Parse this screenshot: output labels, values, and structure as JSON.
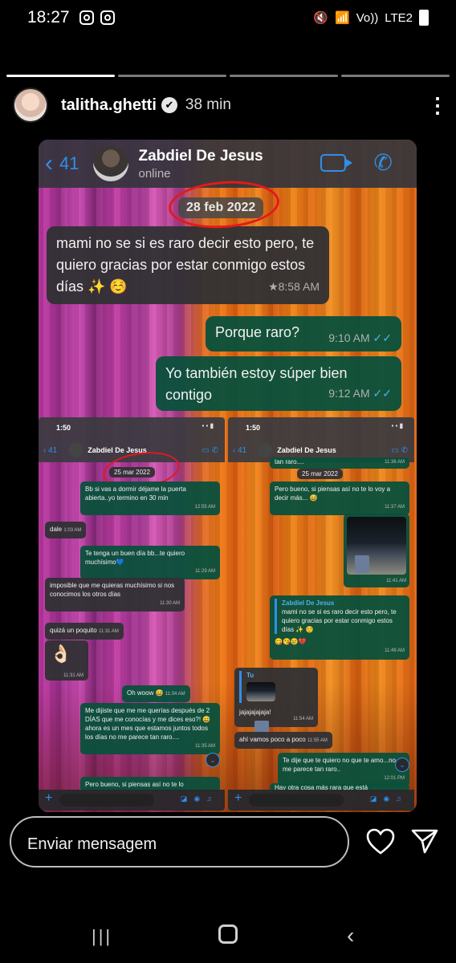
{
  "status_bar": {
    "time": "18:27",
    "network": "LTE2",
    "volte": "Vo))"
  },
  "story": {
    "username": "talitha.ghetti",
    "verified": "✔",
    "time_ago": "38 min",
    "segments_total": 4,
    "segments_done": 1
  },
  "whatsapp": {
    "back_count": "41",
    "contact_name": "Zabdiel De Jesus",
    "contact_status": "online",
    "date_label": "28 feb 2022",
    "messages": [
      {
        "text": "mami no se si es raro decir esto pero, te quiero gracias por estar conmigo estos días ✨ ☺️",
        "time": "★8:58 AM",
        "dir": "in"
      },
      {
        "text": "Porque raro?",
        "time": "9:10 AM",
        "dir": "out"
      },
      {
        "text": "Yo también estoy súper bien contigo",
        "time": "9:12 AM",
        "dir": "out"
      }
    ]
  },
  "mini_left": {
    "clock": "1:50",
    "back_count": "41",
    "name": "Zabdiel De Jesus",
    "date_label": "25 mar 2022",
    "m1": "Bb si vas a dormir déjame la puerta abierta..yo termino en 30 min",
    "m1_time": "12:55 AM",
    "m2": "dale",
    "m2_time": "1:03 AM",
    "m3": "Te tenga un buen día bb...te quiero muchísimo💙",
    "m3_time": "11:29 AM",
    "m4": "imposible que me quieras muchísimo si nos conocimos los otros días",
    "m4_time": "11:30 AM",
    "m5": "quizá un poquito",
    "m5_time": "11:31 AM",
    "m6": "👌🏻",
    "m6_time": "11:31 AM",
    "m7": "Oh woow 😅",
    "m7_time": "11:34 AM",
    "m8": "Me dijiste que me me querías después de 2 DÍAS que me conocías y me dices eso?! 😅 ahora es un mes que estamos juntos todos los días no me parece tan raro....",
    "m8_time": "11:35 AM",
    "m9": "Pero bueno, si piensas así no te lo"
  },
  "mini_right": {
    "clock": "1:50",
    "back_count": "41",
    "name": "Zabdiel De Jesus",
    "top_snip": "tan raro....",
    "top_time": "11:36 AM",
    "date_label": "25 mar 2022",
    "m1": "Pero bueno, si piensas así no te lo voy a decir más... 😅",
    "m1_time": "11:37 AM",
    "photo_time": "11:41 AM",
    "fwd_name": "Zabdiel De Jesus",
    "fwd_text": "mami no se si es raro decir esto pero, te quiero gracias por estar conmigo estos días ✨ ☺️",
    "fwd_emojis": "😋😘😢💔",
    "fwd_time": "11:49 AM",
    "reply_label": "Tu",
    "m2": "jajajajajaja!",
    "m2_time": "11:54 AM",
    "m3": "ahí vamos poco a poco",
    "m3_time": "11:55 AM",
    "m4": "Te dije que te quiero no que te amo...no me parece tan raro..",
    "m4_time": "12:01 PM",
    "m5": "Hay otra cosa más rara que está"
  },
  "reply": {
    "placeholder": "Enviar mensagem"
  }
}
